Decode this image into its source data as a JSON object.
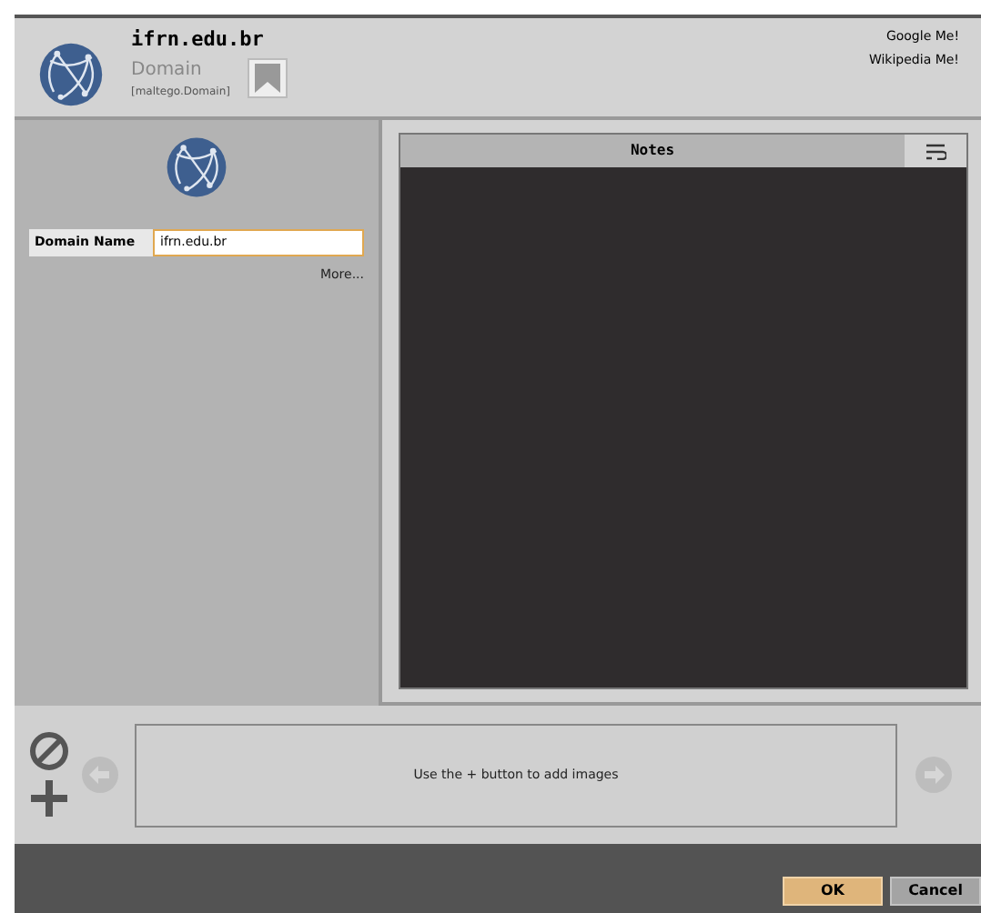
{
  "header": {
    "title": "ifrn.edu.br",
    "type": "Domain",
    "type_id": "[maltego.Domain]",
    "links": [
      "Google Me!",
      "Wikipedia Me!"
    ]
  },
  "properties": [
    {
      "label": "Domain Name",
      "value": "ifrn.edu.br"
    }
  ],
  "more_link": "More...",
  "notes": {
    "title": "Notes"
  },
  "images": {
    "hint": "Use the + button to add images"
  },
  "buttons": [
    {
      "label": "OK",
      "kind": "primary"
    },
    {
      "label": "Cancel",
      "kind": "secondary"
    }
  ]
}
